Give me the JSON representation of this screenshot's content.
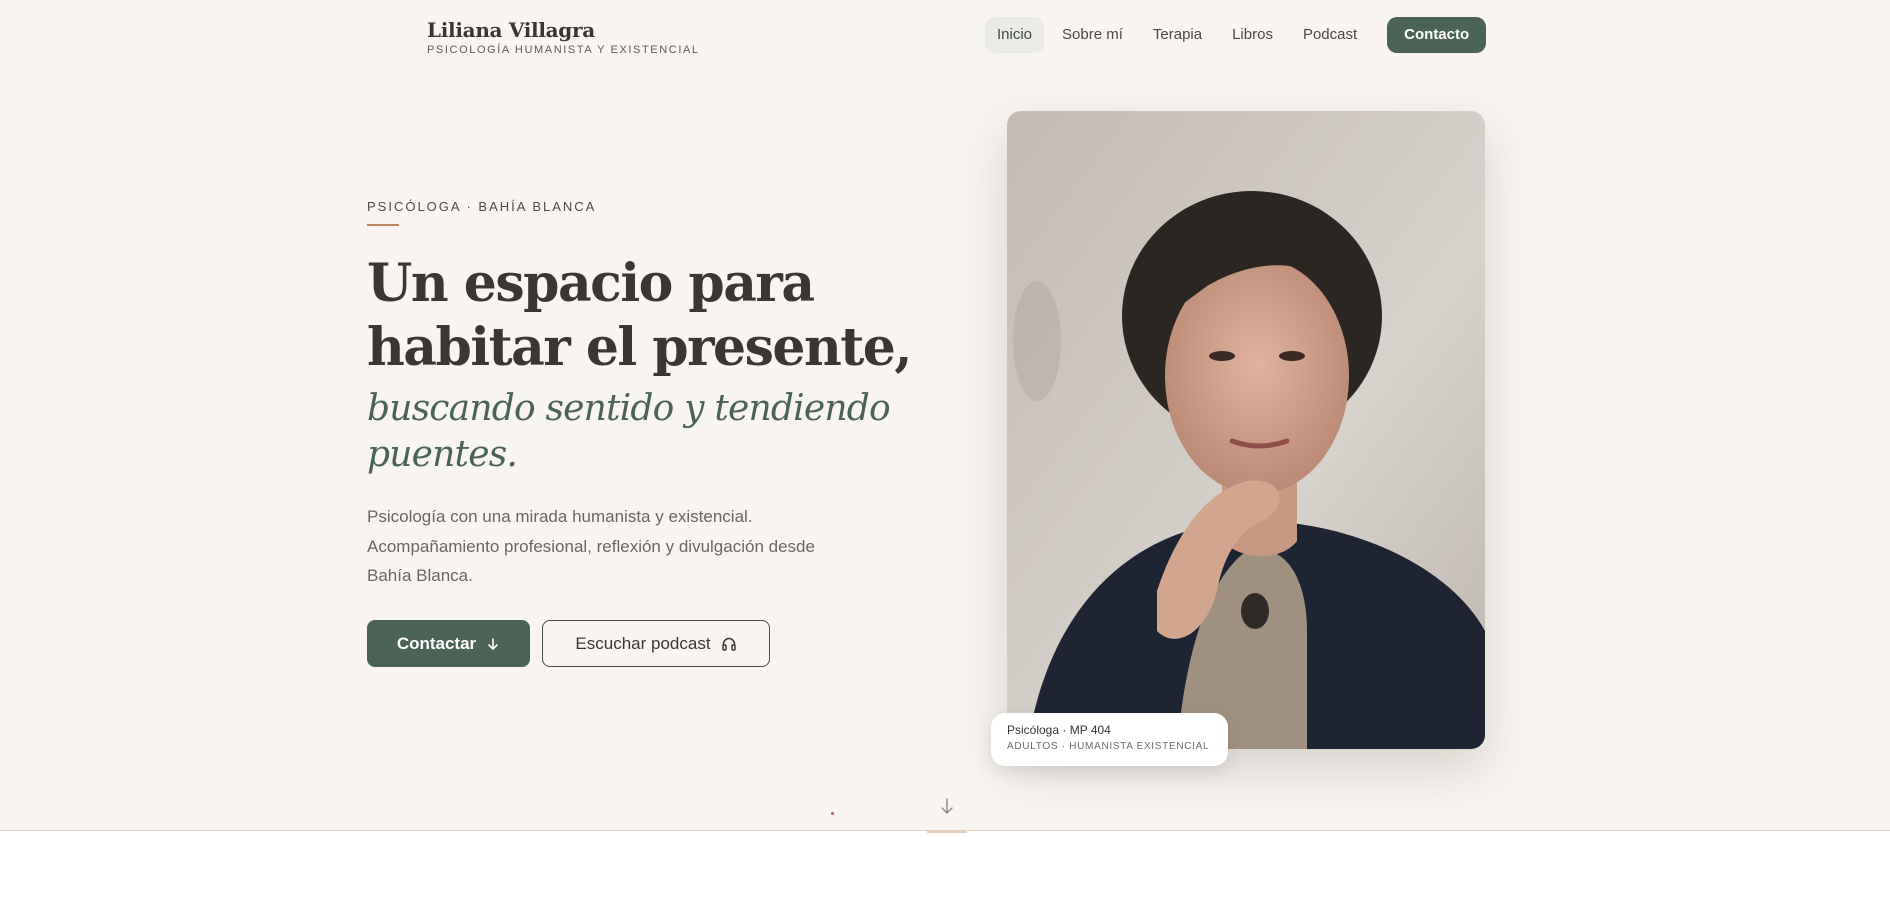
{
  "brand": {
    "name": "Liliana Villagra",
    "tagline": "PSICOLOGÍA HUMANISTA Y EXISTENCIAL"
  },
  "nav": {
    "items": [
      {
        "label": "Inicio",
        "active": true
      },
      {
        "label": "Sobre mí",
        "active": false
      },
      {
        "label": "Terapia",
        "active": false
      },
      {
        "label": "Libros",
        "active": false
      },
      {
        "label": "Podcast",
        "active": false
      }
    ],
    "cta": "Contacto"
  },
  "hero": {
    "eyebrow": "PSICÓLOGA · BAHÍA BLANCA",
    "title": "Un espacio para habitar el presente,",
    "subtitle": "buscando sentido y tendiendo puentes.",
    "lead": "Psicología con una mirada humanista y existencial. Acompañamiento profesional, reflexión y divulgación desde Bahía Blanca.",
    "primary_button": "Contactar",
    "secondary_button": "Escuchar podcast"
  },
  "badge": {
    "title": "Psicóloga · MP 404",
    "subtitle": "ADULTOS · HUMANISTA EXISTENCIAL"
  },
  "icons": {
    "primary_button": "arrow-down-icon",
    "secondary_button": "headphones-icon",
    "scroll": "arrow-down-icon"
  },
  "colors": {
    "accent": "#4b6355",
    "background": "#f8f5f0",
    "divider": "#c08664"
  }
}
